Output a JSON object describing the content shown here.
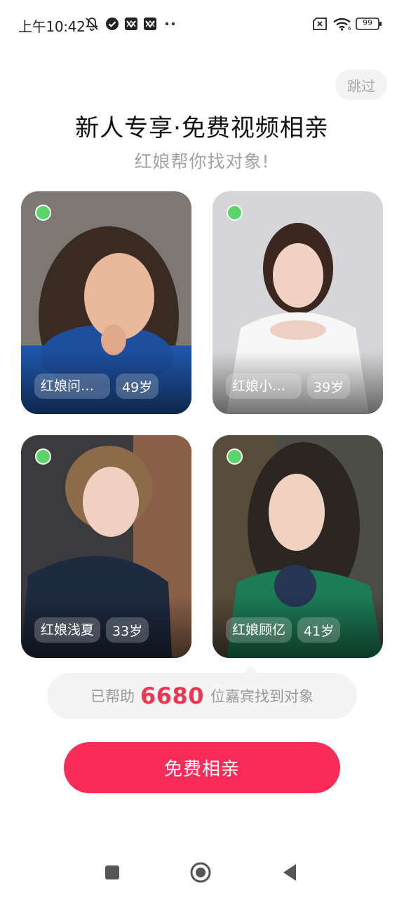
{
  "status_bar": {
    "time": "上午10:42",
    "battery": "99",
    "icons": [
      "mute-bell-icon",
      "check-circle-icon",
      "app-icon",
      "app-icon",
      "more-dots-icon",
      "sim-x-icon",
      "wifi-icon",
      "battery-icon"
    ]
  },
  "header": {
    "skip": "跳过",
    "title": "新人专享·免费视频相亲",
    "subtitle": "红娘帮你找对象!"
  },
  "cards": [
    {
      "name": "红娘问情…",
      "age": "49岁",
      "online": true
    },
    {
      "name": "红娘小茵…",
      "age": "39岁",
      "online": true
    },
    {
      "name": "红娘浅夏",
      "age": "33岁",
      "online": true
    },
    {
      "name": "红娘顾亿",
      "age": "41岁",
      "online": true
    }
  ],
  "helped": {
    "prefix": "已帮助",
    "count": "6680",
    "suffix": "位嘉宾找到对象"
  },
  "cta": {
    "label": "免费相亲"
  },
  "nav": [
    "recents-square-icon",
    "home-circle-icon",
    "back-triangle-icon"
  ],
  "colors": {
    "accent": "#fb2b57",
    "count": "#f0364e",
    "online": "#5bd46a"
  }
}
